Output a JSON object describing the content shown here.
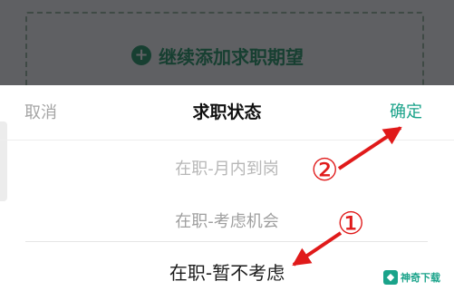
{
  "background_card": {
    "add_label": "继续添加求职期望"
  },
  "sheet": {
    "cancel_label": "取消",
    "title": "求职状态",
    "confirm_label": "确定",
    "options": [
      {
        "label": "在职-月内到岗"
      },
      {
        "label": "在职-考虑机会"
      },
      {
        "label": "在职-暂不考虑",
        "selected": true
      }
    ]
  },
  "annotations": {
    "marker_1": "①",
    "marker_2": "②",
    "arrow_color": "#e01a1a"
  },
  "watermark": {
    "text": "神奇下载"
  },
  "colors": {
    "accent": "#1aa38a",
    "overlay": "#5f6063"
  }
}
